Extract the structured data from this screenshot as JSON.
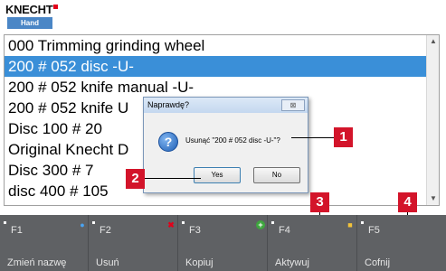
{
  "header": {
    "brand": "KNECHT",
    "mode": "Hand",
    "brand_color": "#e2001a",
    "mode_color": "#4a86c6"
  },
  "list": {
    "items": [
      {
        "label": "000 Trimming grinding wheel",
        "selected": false
      },
      {
        "label": "200 # 052 disc -U-",
        "selected": true
      },
      {
        "label": "200 # 052 knife manual -U-",
        "selected": false
      },
      {
        "label": "200 # 052 knife U",
        "selected": false
      },
      {
        "label": "Disc 100 # 20",
        "selected": false
      },
      {
        "label": "Original Knecht D",
        "selected": false
      },
      {
        "label": "Disc 300 # 7",
        "selected": false
      },
      {
        "label": "disc 400 # 105",
        "selected": false
      }
    ],
    "selection_color": "#3a8fd8"
  },
  "dialog": {
    "title": "Naprawdę?",
    "close_label": "⊠",
    "icon": "question-icon",
    "message": "Usunąć \"200 # 052 disc -U-\"?",
    "yes_label": "Yes",
    "no_label": "No"
  },
  "callouts": {
    "c1": "1",
    "c2": "2",
    "c3": "3",
    "c4": "4",
    "color": "#d3142a"
  },
  "function_keys": [
    {
      "code": "F1",
      "label": "Zmień nazwę",
      "icon": "info-icon"
    },
    {
      "code": "F2",
      "label": "Usuń",
      "icon": "delete-x-icon"
    },
    {
      "code": "F3",
      "label": "Kopiuj",
      "icon": "add-plus-icon"
    },
    {
      "code": "F4",
      "label": "Aktywuj",
      "icon": "activate-icon"
    },
    {
      "code": "F5",
      "label": "Cofnij",
      "icon": ""
    }
  ]
}
